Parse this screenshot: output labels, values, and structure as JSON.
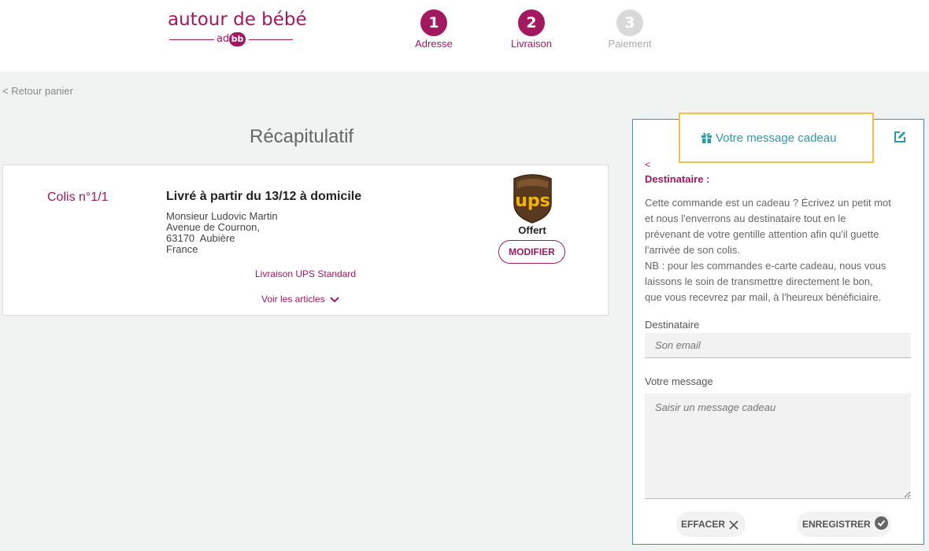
{
  "brand": {
    "name": "autour de bébé",
    "badge_left": "ad",
    "badge_right": "bb"
  },
  "steps": [
    {
      "number": "1",
      "label": "Adresse",
      "state": "active"
    },
    {
      "number": "2",
      "label": "Livraison",
      "state": "active"
    },
    {
      "number": "3",
      "label": "Paiement",
      "state": "inactive"
    }
  ],
  "back_link": "< Retour panier",
  "recap": {
    "title": "Récapitulatif",
    "parcel": {
      "number": "Colis n°1/1",
      "heading": "Livré à partir du 13/12 à domicile",
      "address_lines": [
        "Monsieur Ludovic Martin",
        "Avenue de Cournon,",
        "63170  Aubière",
        "France"
      ],
      "carrier_logo": "ups-logo",
      "price": "Offert",
      "modify_label": "MODIFIER",
      "shipping_method": "Livraison UPS Standard",
      "see_items_label": "Voir les articles"
    }
  },
  "gift": {
    "tab_title": "Votre message cadeau",
    "back": "<",
    "recipient_title": "Destinataire :",
    "description_lines": [
      "Cette commande est un cadeau ? Écrivez un petit mot",
      "et nous l'enverrons au destinataire tout en le",
      "prévenant de votre gentille attention afin qu'il guette",
      "l'arrivée de son colis.",
      "NB : pour les commandes e-carte cadeau, nous vous",
      "laissons le soin de transmettre directement le bon,",
      "que vous recevrez par mail, à l'heureux bénéficiaire."
    ],
    "recipient_label": "Destinataire",
    "recipient_placeholder": "Son email",
    "message_label": "Votre message",
    "message_placeholder": "Saisir un message cadeau",
    "clear_label": "EFFACER",
    "save_label": "ENREGISTRER"
  },
  "colors": {
    "brand": "#a3185e",
    "accent": "#2c9ba6",
    "highlight": "#f4bf45",
    "ups_brown": "#5a3a1e",
    "ups_gold": "#f5b400"
  }
}
